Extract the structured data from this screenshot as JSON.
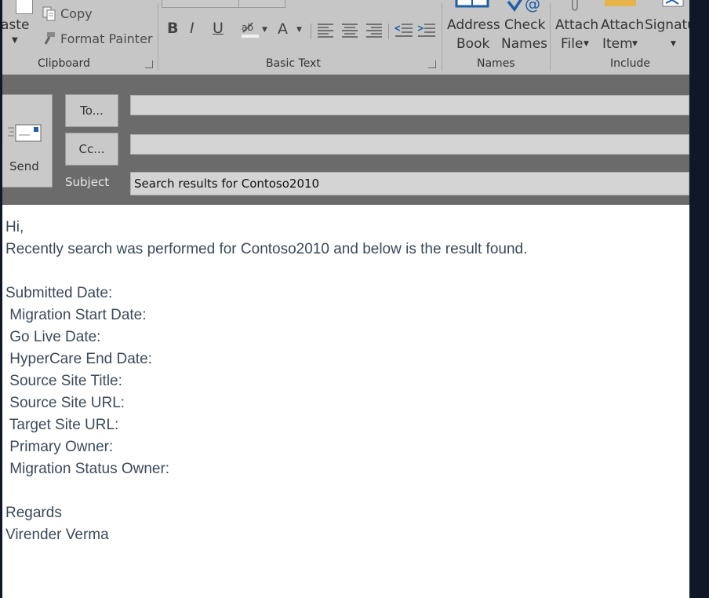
{
  "ribbon": {
    "paste_label": "aste",
    "copy_label": "Copy",
    "format_painter_label": "Format Painter",
    "group_clipboard": "Clipboard",
    "group_basic_text": "Basic Text",
    "group_names": "Names",
    "group_include": "Include",
    "address_book_line1": "Address",
    "address_book_line2": "Book",
    "check_names_line1": "Check",
    "check_names_line2": "Names",
    "attach_file_line1": "Attach",
    "attach_file_line2": "File",
    "attach_item_line1": "Attach",
    "attach_item_line2": "Item",
    "signature_line1": "Signatu",
    "bold": "B",
    "italic": "I",
    "underline": "U"
  },
  "compose": {
    "send_label": "Send",
    "to_label": "To...",
    "cc_label": "Cc...",
    "subject_label": "Subject",
    "to_value": "",
    "cc_value": "",
    "subject_value": "Search results for Contoso2010"
  },
  "body": {
    "lines": [
      "Hi,",
      "Recently search was performed for Contoso2010 and below is the result found.",
      "",
      "Submitted Date:",
      " Migration Start Date:",
      " Go Live Date:",
      " HyperCare End Date:",
      " Source Site Title:",
      " Source Site URL:",
      " Target Site URL:",
      " Primary Owner:",
      " Migration Status Owner:",
      "",
      "Regards",
      "Virender Verma"
    ]
  },
  "colors": {
    "ribbon_bg": "#c6c6c6",
    "header_bg": "#6b6b6b",
    "body_text": "#3b4a5a",
    "accent_blue": "#1f5fa8",
    "window_edge": "#101828"
  }
}
